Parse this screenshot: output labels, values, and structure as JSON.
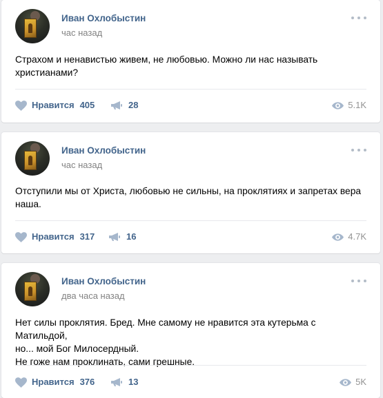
{
  "colors": {
    "background": "#edeef0",
    "card": "#ffffff",
    "link": "#42648b",
    "meta": "#828282",
    "icon": "#a6b7cc",
    "divider": "#e7e8ec"
  },
  "icons": {
    "like": "heart-icon",
    "share": "megaphone-icon",
    "views": "eye-icon",
    "more": "more-dots-icon"
  },
  "posts": [
    {
      "author": "Иван Охлобыстин",
      "time": "час назад",
      "lines": [
        "Страхом и ненавистью живем, не любовью. Можно ли нас называть",
        "христианами?"
      ],
      "like_label": "Нравится",
      "likes": "405",
      "shares": "28",
      "views": "5.1K"
    },
    {
      "author": "Иван Охлобыстин",
      "time": "час назад",
      "lines": [
        "Отступили мы от Христа, любовью не сильны, на проклятиях и запретах вера",
        "наша."
      ],
      "like_label": "Нравится",
      "likes": "317",
      "shares": "16",
      "views": "4.7K"
    },
    {
      "author": "Иван Охлобыстин",
      "time": "два часа назад",
      "lines": [
        "Нет силы проклятия. Бред. Мне самому не нравится эта кутерьма с Матильдой,",
        "но... мой Бог Милосердный.",
        "Не гоже нам проклинать, сами грешные."
      ],
      "like_label": "Нравится",
      "likes": "376",
      "shares": "13",
      "views": "5K"
    }
  ]
}
